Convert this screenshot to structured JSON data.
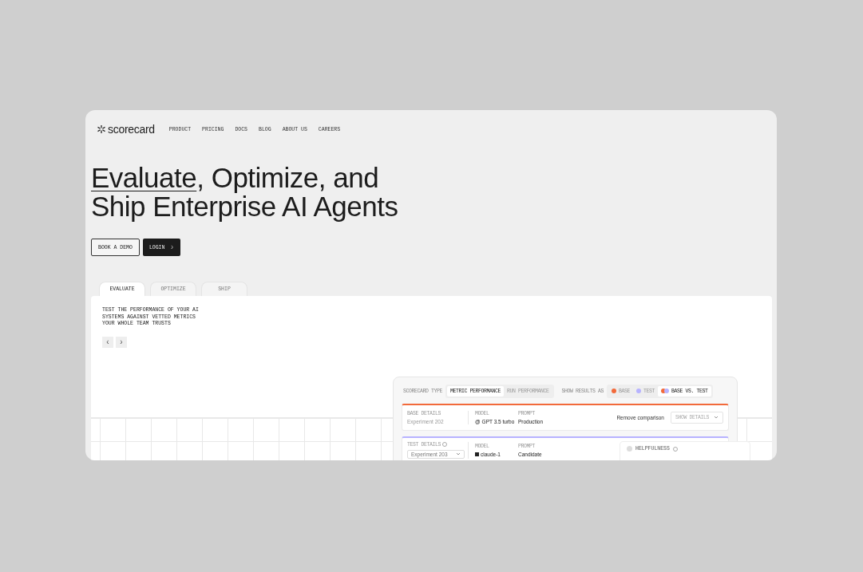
{
  "brand": {
    "name": "scorecard"
  },
  "nav": [
    "PRODUCT",
    "PRICING",
    "DOCS",
    "BLOG",
    "ABOUT US",
    "CAREERS"
  ],
  "headline": {
    "link": "Evaluate",
    "text": ", Optimize, and Ship Enterprise AI Agents"
  },
  "buttons": [
    {
      "label": "BOOK A DEMO",
      "kind": "outline"
    },
    {
      "label": "LOGIN",
      "kind": "dark",
      "arrow": "›"
    }
  ],
  "tabs": [
    {
      "label": "EVALUATE",
      "selected": true
    },
    {
      "label": "OPTIMIZE",
      "selected": false
    },
    {
      "label": "SHIP",
      "selected": false
    }
  ],
  "panel": {
    "text": "TEST THE PERFORMANCE OF YOUR AI SYSTEMS AGAINST VETTED METRICS YOUR WHOLE TEAM TRUSTS",
    "prev": "‹",
    "next": "›"
  },
  "scorecard": {
    "type_label": "SCORECARD TYPE",
    "types": [
      {
        "label": "METRIC PERFORMANCE",
        "selected": true
      },
      {
        "label": "RUN PERFORMANCE",
        "selected": false
      }
    ],
    "results_label": "SHOW RESULTS AS",
    "results": [
      {
        "label": "BASE",
        "selected": false,
        "dots": [
          {
            "color": "#f26a3b"
          }
        ]
      },
      {
        "label": "TEST",
        "selected": false,
        "dots": [
          {
            "color": "#b7b3ff"
          }
        ]
      },
      {
        "label": "BASE VS. TEST",
        "selected": true,
        "dots": [
          {
            "color": "#f26a3b"
          },
          {
            "color": "#b7b3ff"
          }
        ]
      }
    ],
    "runs": [
      {
        "label": "BASE DETAILS",
        "color": "#f26a3b",
        "experiment": "Experiment 202",
        "dropdown": false,
        "info": false,
        "model_label": "MODEL",
        "model": "GPT 3.5 turbo",
        "model_prefix": "@",
        "prompt_label": "PROMPT",
        "prompt": "Production",
        "remove": "Remove comparison",
        "details": "SHOW DETAILS"
      },
      {
        "label": "TEST DETAILS",
        "color": "#b7b3ff",
        "experiment": "Experiment 203",
        "dropdown": true,
        "info": true,
        "model_label": "MODEL",
        "model": "claude-1",
        "prompt_label": "PROMPT",
        "prompt": "Candidate"
      }
    ],
    "metric": {
      "label": "HELPFULNESS"
    }
  }
}
